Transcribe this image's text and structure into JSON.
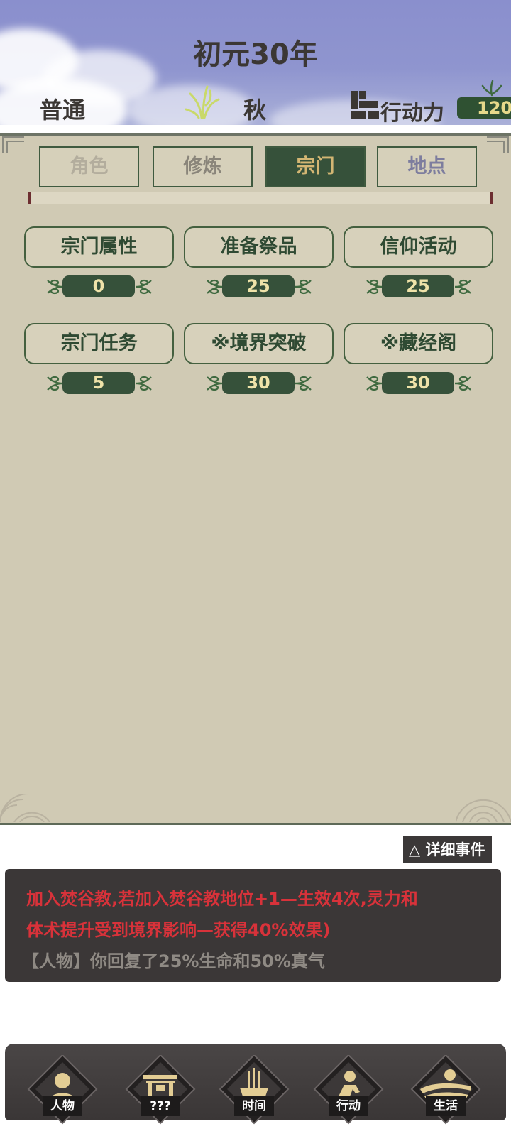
{
  "header": {
    "year": "初元30年",
    "difficulty": "普通",
    "season": "秋",
    "action_label": "行动力",
    "action_points": "120"
  },
  "tabs": [
    {
      "label": "角色"
    },
    {
      "label": "修炼"
    },
    {
      "label": "宗门"
    },
    {
      "label": "地点"
    }
  ],
  "sect_actions": [
    {
      "label": "宗门属性",
      "value": "0"
    },
    {
      "label": "准备祭品",
      "value": "25"
    },
    {
      "label": "信仰活动",
      "value": "25"
    },
    {
      "label": "宗门任务",
      "value": "5"
    },
    {
      "label": "※境界突破",
      "value": "30"
    },
    {
      "label": "※藏经阁",
      "value": "30"
    }
  ],
  "log": {
    "detail_button": "△ 详细事件",
    "line1": "加入焚谷教,若加入焚谷教地位+1—生效4次,灵力和",
    "line2": "体术提升受到境界影响—获得40%效果)",
    "line3": "【人物】你回复了25%生命和50%真气"
  },
  "nav": [
    {
      "label": "人物",
      "icon": "person-icon"
    },
    {
      "label": "???",
      "icon": "gate-icon"
    },
    {
      "label": "时间",
      "icon": "incense-icon"
    },
    {
      "label": "行动",
      "icon": "action-figure-icon"
    },
    {
      "label": "生活",
      "icon": "landscape-icon"
    }
  ],
  "colors": {
    "panel_bg": "#d0cab4",
    "accent_green": "#36513a",
    "log_red": "#d8323a"
  }
}
